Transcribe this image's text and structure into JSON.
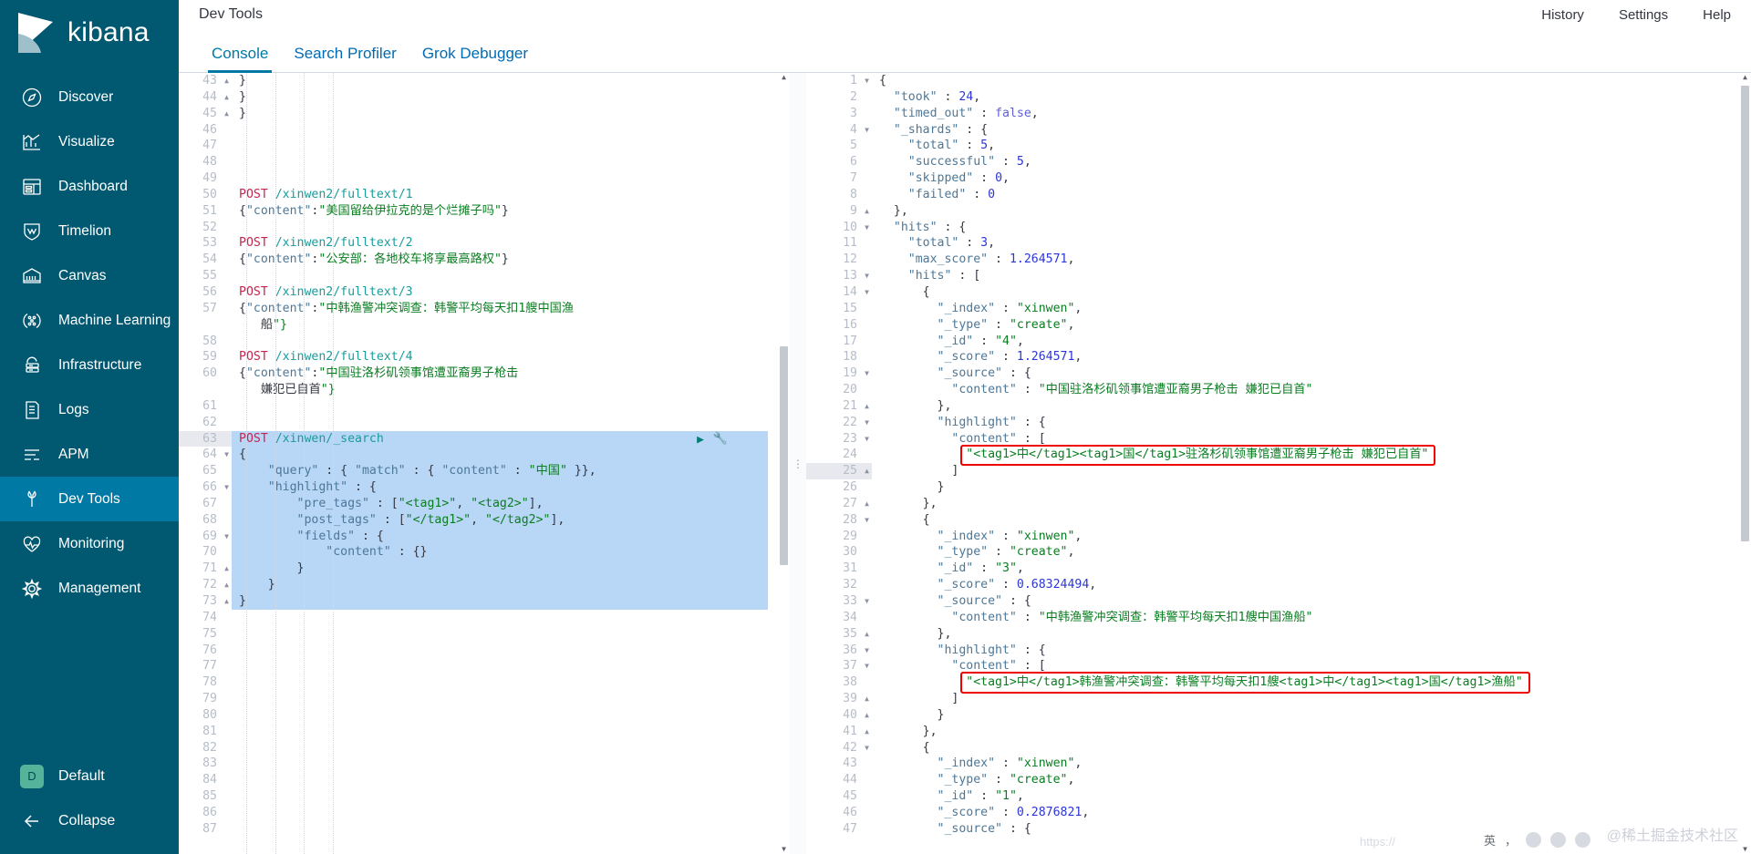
{
  "app": {
    "brand": "kibana",
    "brand_icon": "kibana-logo-icon"
  },
  "sidebar": {
    "items": [
      {
        "label": "Discover",
        "icon": "compass-icon",
        "active": false
      },
      {
        "label": "Visualize",
        "icon": "bar-chart-icon",
        "active": false
      },
      {
        "label": "Dashboard",
        "icon": "dashboard-grid-icon",
        "active": false
      },
      {
        "label": "Timelion",
        "icon": "timelion-shield-icon",
        "active": false
      },
      {
        "label": "Canvas",
        "icon": "canvas-icon",
        "active": false
      },
      {
        "label": "Machine Learning",
        "icon": "machine-learning-icon",
        "active": false
      },
      {
        "label": "Infrastructure",
        "icon": "infrastructure-icon",
        "active": false
      },
      {
        "label": "Logs",
        "icon": "logs-document-icon",
        "active": false
      },
      {
        "label": "APM",
        "icon": "apm-lines-icon",
        "active": false
      },
      {
        "label": "Dev Tools",
        "icon": "wrench-icon",
        "active": true
      },
      {
        "label": "Monitoring",
        "icon": "heartbeat-icon",
        "active": false
      },
      {
        "label": "Management",
        "icon": "gear-icon",
        "active": false
      }
    ],
    "space": {
      "badge": "D",
      "label": "Default"
    },
    "collapse": {
      "label": "Collapse",
      "icon": "arrow-left-icon"
    }
  },
  "header": {
    "title": "Dev Tools",
    "links": [
      "History",
      "Settings",
      "Help"
    ]
  },
  "tabs": [
    {
      "label": "Console",
      "active": true
    },
    {
      "label": "Search Profiler",
      "active": false
    },
    {
      "label": "Grok Debugger",
      "active": false
    }
  ],
  "colors": {
    "sidebar_bg": "#015971",
    "sidebar_active": "#0079a5",
    "accent": "#0079a5",
    "link": "#006bb4",
    "selection": "#b8d6f6",
    "annotation_box": "#ee0000",
    "string_green": "#0a7d21",
    "number_blue": "#2b36d4",
    "method_pink": "#c7254e",
    "url_teal": "#1a9c9c",
    "key_slate": "#4c7899",
    "space_badge": "#54b399"
  },
  "editor": {
    "first_line": 43,
    "selected_lines": [
      63,
      64,
      65,
      66,
      67,
      68,
      69,
      70,
      71,
      72,
      73
    ],
    "run_button": "play-icon",
    "wrench_button": "wrench-icon",
    "lines": [
      {
        "n": 43,
        "fold": "up",
        "indent": 6,
        "text": "}"
      },
      {
        "n": 44,
        "fold": "up",
        "indent": 4,
        "text": "}"
      },
      {
        "n": 45,
        "fold": "up",
        "indent": 0,
        "text": "}"
      },
      {
        "n": 46,
        "text": ""
      },
      {
        "n": 47,
        "text": ""
      },
      {
        "n": 48,
        "text": ""
      },
      {
        "n": 49,
        "text": ""
      },
      {
        "n": 50,
        "text": "POST /xinwen2/fulltext/1",
        "kind": "request"
      },
      {
        "n": 51,
        "text": "{\"content\":\"美国留给伊拉克的是个烂摊子吗\"}",
        "kind": "body"
      },
      {
        "n": 52,
        "text": ""
      },
      {
        "n": 53,
        "text": "POST /xinwen2/fulltext/2",
        "kind": "request"
      },
      {
        "n": 54,
        "text": "{\"content\":\"公安部：各地校车将享最高路权\"}",
        "kind": "body"
      },
      {
        "n": 55,
        "text": ""
      },
      {
        "n": 56,
        "text": "POST /xinwen2/fulltext/3",
        "kind": "request"
      },
      {
        "n": 57,
        "text": "{\"content\":\"中韩渔警冲突调查：韩警平均每天扣1艘中国渔",
        "kind": "body"
      },
      {
        "n": "",
        "text": "   船\"}",
        "kind": "body-cont"
      },
      {
        "n": 58,
        "text": ""
      },
      {
        "n": 59,
        "text": "POST /xinwen2/fulltext/4",
        "kind": "request"
      },
      {
        "n": 60,
        "text": "{\"content\":\"中国驻洛杉矶领事馆遭亚裔男子枪击",
        "kind": "body"
      },
      {
        "n": "",
        "text": "   嫌犯已自首\"}",
        "kind": "body-cont"
      },
      {
        "n": 61,
        "text": ""
      },
      {
        "n": 62,
        "text": ""
      },
      {
        "n": 63,
        "text": "POST /xinwen/_search",
        "kind": "request"
      },
      {
        "n": 64,
        "fold": "down",
        "text": "{"
      },
      {
        "n": 65,
        "text": "    \"query\" : { \"match\" : { \"content\" : \"中国\" }},"
      },
      {
        "n": 66,
        "fold": "down",
        "text": "    \"highlight\" : {"
      },
      {
        "n": 67,
        "text": "        \"pre_tags\" : [\"<tag1>\", \"<tag2>\"],"
      },
      {
        "n": 68,
        "text": "        \"post_tags\" : [\"</tag1>\", \"</tag2>\"],"
      },
      {
        "n": 69,
        "fold": "down",
        "text": "        \"fields\" : {"
      },
      {
        "n": 70,
        "text": "            \"content\" : {}"
      },
      {
        "n": 71,
        "fold": "up",
        "text": "        }"
      },
      {
        "n": 72,
        "fold": "up",
        "text": "    }"
      },
      {
        "n": 73,
        "fold": "up",
        "text": "}"
      },
      {
        "n": 74,
        "text": ""
      },
      {
        "n": 75,
        "text": ""
      },
      {
        "n": 76,
        "text": ""
      },
      {
        "n": 77,
        "text": ""
      },
      {
        "n": 78,
        "text": ""
      },
      {
        "n": 79,
        "text": ""
      },
      {
        "n": 80,
        "text": ""
      },
      {
        "n": 81,
        "text": ""
      },
      {
        "n": 82,
        "text": ""
      },
      {
        "n": 83,
        "text": ""
      },
      {
        "n": 84,
        "text": ""
      },
      {
        "n": 85,
        "text": ""
      },
      {
        "n": 86,
        "text": ""
      },
      {
        "n": 87,
        "text": ""
      }
    ]
  },
  "response": {
    "first_line": 1,
    "selected_lines": [
      25
    ],
    "annotated_lines": [
      25,
      38
    ],
    "lines": [
      {
        "n": 1,
        "fold": "down",
        "text": "{"
      },
      {
        "n": 2,
        "text": "  \"took\" : 24,"
      },
      {
        "n": 3,
        "text": "  \"timed_out\" : false,"
      },
      {
        "n": 4,
        "fold": "down",
        "text": "  \"_shards\" : {"
      },
      {
        "n": 5,
        "text": "    \"total\" : 5,"
      },
      {
        "n": 6,
        "text": "    \"successful\" : 5,"
      },
      {
        "n": 7,
        "text": "    \"skipped\" : 0,"
      },
      {
        "n": 8,
        "text": "    \"failed\" : 0"
      },
      {
        "n": 9,
        "fold": "up",
        "text": "  },"
      },
      {
        "n": 10,
        "fold": "down",
        "text": "  \"hits\" : {"
      },
      {
        "n": 11,
        "text": "    \"total\" : 3,"
      },
      {
        "n": 12,
        "text": "    \"max_score\" : 1.264571,"
      },
      {
        "n": 13,
        "fold": "down",
        "text": "    \"hits\" : ["
      },
      {
        "n": 14,
        "fold": "down",
        "text": "      {"
      },
      {
        "n": 15,
        "text": "        \"_index\" : \"xinwen\","
      },
      {
        "n": 16,
        "text": "        \"_type\" : \"create\","
      },
      {
        "n": 17,
        "text": "        \"_id\" : \"4\","
      },
      {
        "n": 18,
        "text": "        \"_score\" : 1.264571,"
      },
      {
        "n": 19,
        "fold": "down",
        "text": "        \"_source\" : {"
      },
      {
        "n": 20,
        "text": "          \"content\" : \"中国驻洛杉矶领事馆遭亚裔男子枪击 嫌犯已自首\""
      },
      {
        "n": 21,
        "fold": "up",
        "text": "        },"
      },
      {
        "n": 22,
        "fold": "down",
        "text": "        \"highlight\" : {"
      },
      {
        "n": 23,
        "fold": "down",
        "text": "          \"content\" : ["
      },
      {
        "n": 24,
        "text": "            \"<tag1>中</tag1><tag1>国</tag1>驻洛杉矶领事馆遭亚裔男子枪击 嫌犯已自首\""
      },
      {
        "n": 25,
        "fold": "up",
        "text": "          ]"
      },
      {
        "n": 26,
        "text": "        }"
      },
      {
        "n": 27,
        "fold": "up",
        "text": "      },"
      },
      {
        "n": 28,
        "fold": "down",
        "text": "      {"
      },
      {
        "n": 29,
        "text": "        \"_index\" : \"xinwen\","
      },
      {
        "n": 30,
        "text": "        \"_type\" : \"create\","
      },
      {
        "n": 31,
        "text": "        \"_id\" : \"3\","
      },
      {
        "n": 32,
        "text": "        \"_score\" : 0.68324494,"
      },
      {
        "n": 33,
        "fold": "down",
        "text": "        \"_source\" : {"
      },
      {
        "n": 34,
        "text": "          \"content\" : \"中韩渔警冲突调查：韩警平均每天扣1艘中国渔船\""
      },
      {
        "n": 35,
        "fold": "up",
        "text": "        },"
      },
      {
        "n": 36,
        "fold": "down",
        "text": "        \"highlight\" : {"
      },
      {
        "n": 37,
        "fold": "down",
        "text": "          \"content\" : ["
      },
      {
        "n": 38,
        "text": "            \"<tag1>中</tag1>韩渔警冲突调查：韩警平均每天扣1艘<tag1>中</tag1><tag1>国</tag1>渔船\""
      },
      {
        "n": 39,
        "fold": "up",
        "text": "          ]"
      },
      {
        "n": 40,
        "fold": "up",
        "text": "        }"
      },
      {
        "n": 41,
        "fold": "up",
        "text": "      },"
      },
      {
        "n": 42,
        "fold": "down",
        "text": "      {"
      },
      {
        "n": 43,
        "text": "        \"_index\" : \"xinwen\","
      },
      {
        "n": 44,
        "text": "        \"_type\" : \"create\","
      },
      {
        "n": 45,
        "text": "        \"_id\" : \"1\","
      },
      {
        "n": 46,
        "text": "        \"_score\" : 0.2876821,"
      },
      {
        "n": 47,
        "text": "        \"_source\" : {"
      }
    ]
  },
  "watermark": {
    "text": "@稀土掘金技术社区",
    "ghost_url": "https://"
  },
  "ime": {
    "lang": "英",
    "punct": "，",
    "smiley": "smiley-icon",
    "mic": "mic-icon",
    "keyboard": "keyboard-icon"
  }
}
